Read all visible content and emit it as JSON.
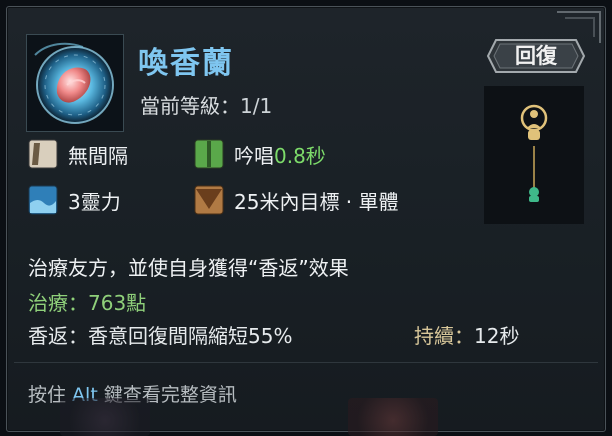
{
  "skill": {
    "name": "喚香蘭",
    "level_label": "當前等級：",
    "level_value": "1/1",
    "type_badge": "回復"
  },
  "stats": {
    "interval": "無間隔",
    "cast_label": "吟唱",
    "cast_value": "0.8秒",
    "cost": "3靈力",
    "range": "25米內目標 · 單體"
  },
  "description": {
    "main": "治療友方，並使自身獲得“香返”效果",
    "heal_label": "治療：",
    "heal_value": "763點",
    "fragrance_label": "香返：",
    "fragrance_value": "香意回復間隔縮短55%",
    "duration_label": "持續：",
    "duration_value": "12秒"
  },
  "hint": {
    "prefix": "按住 ",
    "key": "Alt",
    "suffix": " 鍵查看完整資訊"
  },
  "colors": {
    "title": "#7fc6f0",
    "heal": "#8fd07a",
    "cast_value": "#7ddb6a"
  }
}
